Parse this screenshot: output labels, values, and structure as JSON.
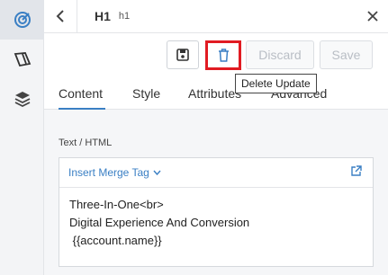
{
  "rail": {
    "items": [
      {
        "icon": "target-icon",
        "active": true
      },
      {
        "icon": "tag-icon",
        "active": false
      },
      {
        "icon": "layers-icon",
        "active": false
      }
    ]
  },
  "header": {
    "title": "H1",
    "subtitle": "h1"
  },
  "toolbar": {
    "discard_label": "Discard",
    "save_label": "Save"
  },
  "tooltip": {
    "text": "Delete Update"
  },
  "tabs": [
    {
      "label": "Content",
      "active": true
    },
    {
      "label": "Style",
      "active": false
    },
    {
      "label": "Attributes",
      "active": false
    },
    {
      "label": "Advanced",
      "active": false
    }
  ],
  "field": {
    "label": "Text / HTML",
    "merge_tag_label": "Insert Merge Tag",
    "lines": [
      "Three-In-One<br>",
      "Digital Experience And Conversion",
      " {{account.name}}"
    ]
  },
  "colors": {
    "accent": "#3a7fc4",
    "highlight": "#e11b22"
  }
}
